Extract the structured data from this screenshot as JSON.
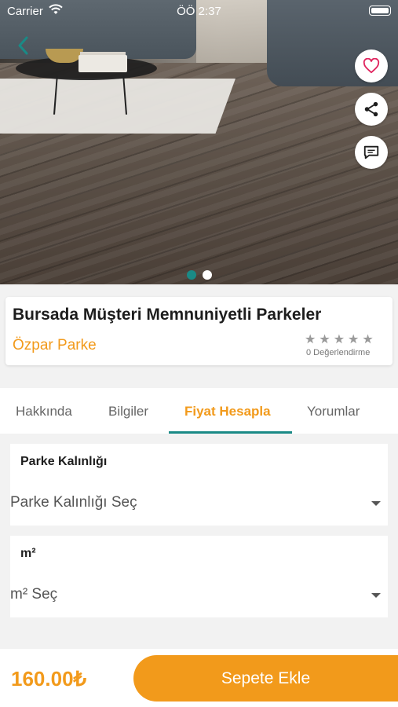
{
  "status_bar": {
    "carrier": "Carrier",
    "time": "ÖÖ 2:37"
  },
  "gallery": {
    "page_count": 2,
    "active_page": 1
  },
  "product": {
    "title": "Bursada Müşteri Memnuniyetli Parkeler",
    "brand": "Özpar Parke",
    "rating_stars": 0,
    "rating_count_label": "0 Değerlendirme"
  },
  "tabs": [
    {
      "label": "Hakkında",
      "active": false
    },
    {
      "label": "Bilgiler",
      "active": false
    },
    {
      "label": "Fiyat Hesapla",
      "active": true
    },
    {
      "label": "Yorumlar",
      "active": false
    }
  ],
  "calculator": {
    "thickness": {
      "label": "Parke Kalınlığı",
      "placeholder": "Parke Kalınlığı Seç"
    },
    "area": {
      "label": "m²",
      "placeholder": "m² Seç"
    }
  },
  "footer": {
    "price": "160.00₺",
    "add_to_cart_label": "Sepete Ekle"
  },
  "colors": {
    "accent_orange": "#f29a1b",
    "teal": "#1a8a86"
  },
  "icons": {
    "back": "chevron-left-icon",
    "favorite": "heart-icon",
    "share": "share-icon",
    "comment": "chat-bubble-icon",
    "dropdown": "caret-down-icon"
  }
}
